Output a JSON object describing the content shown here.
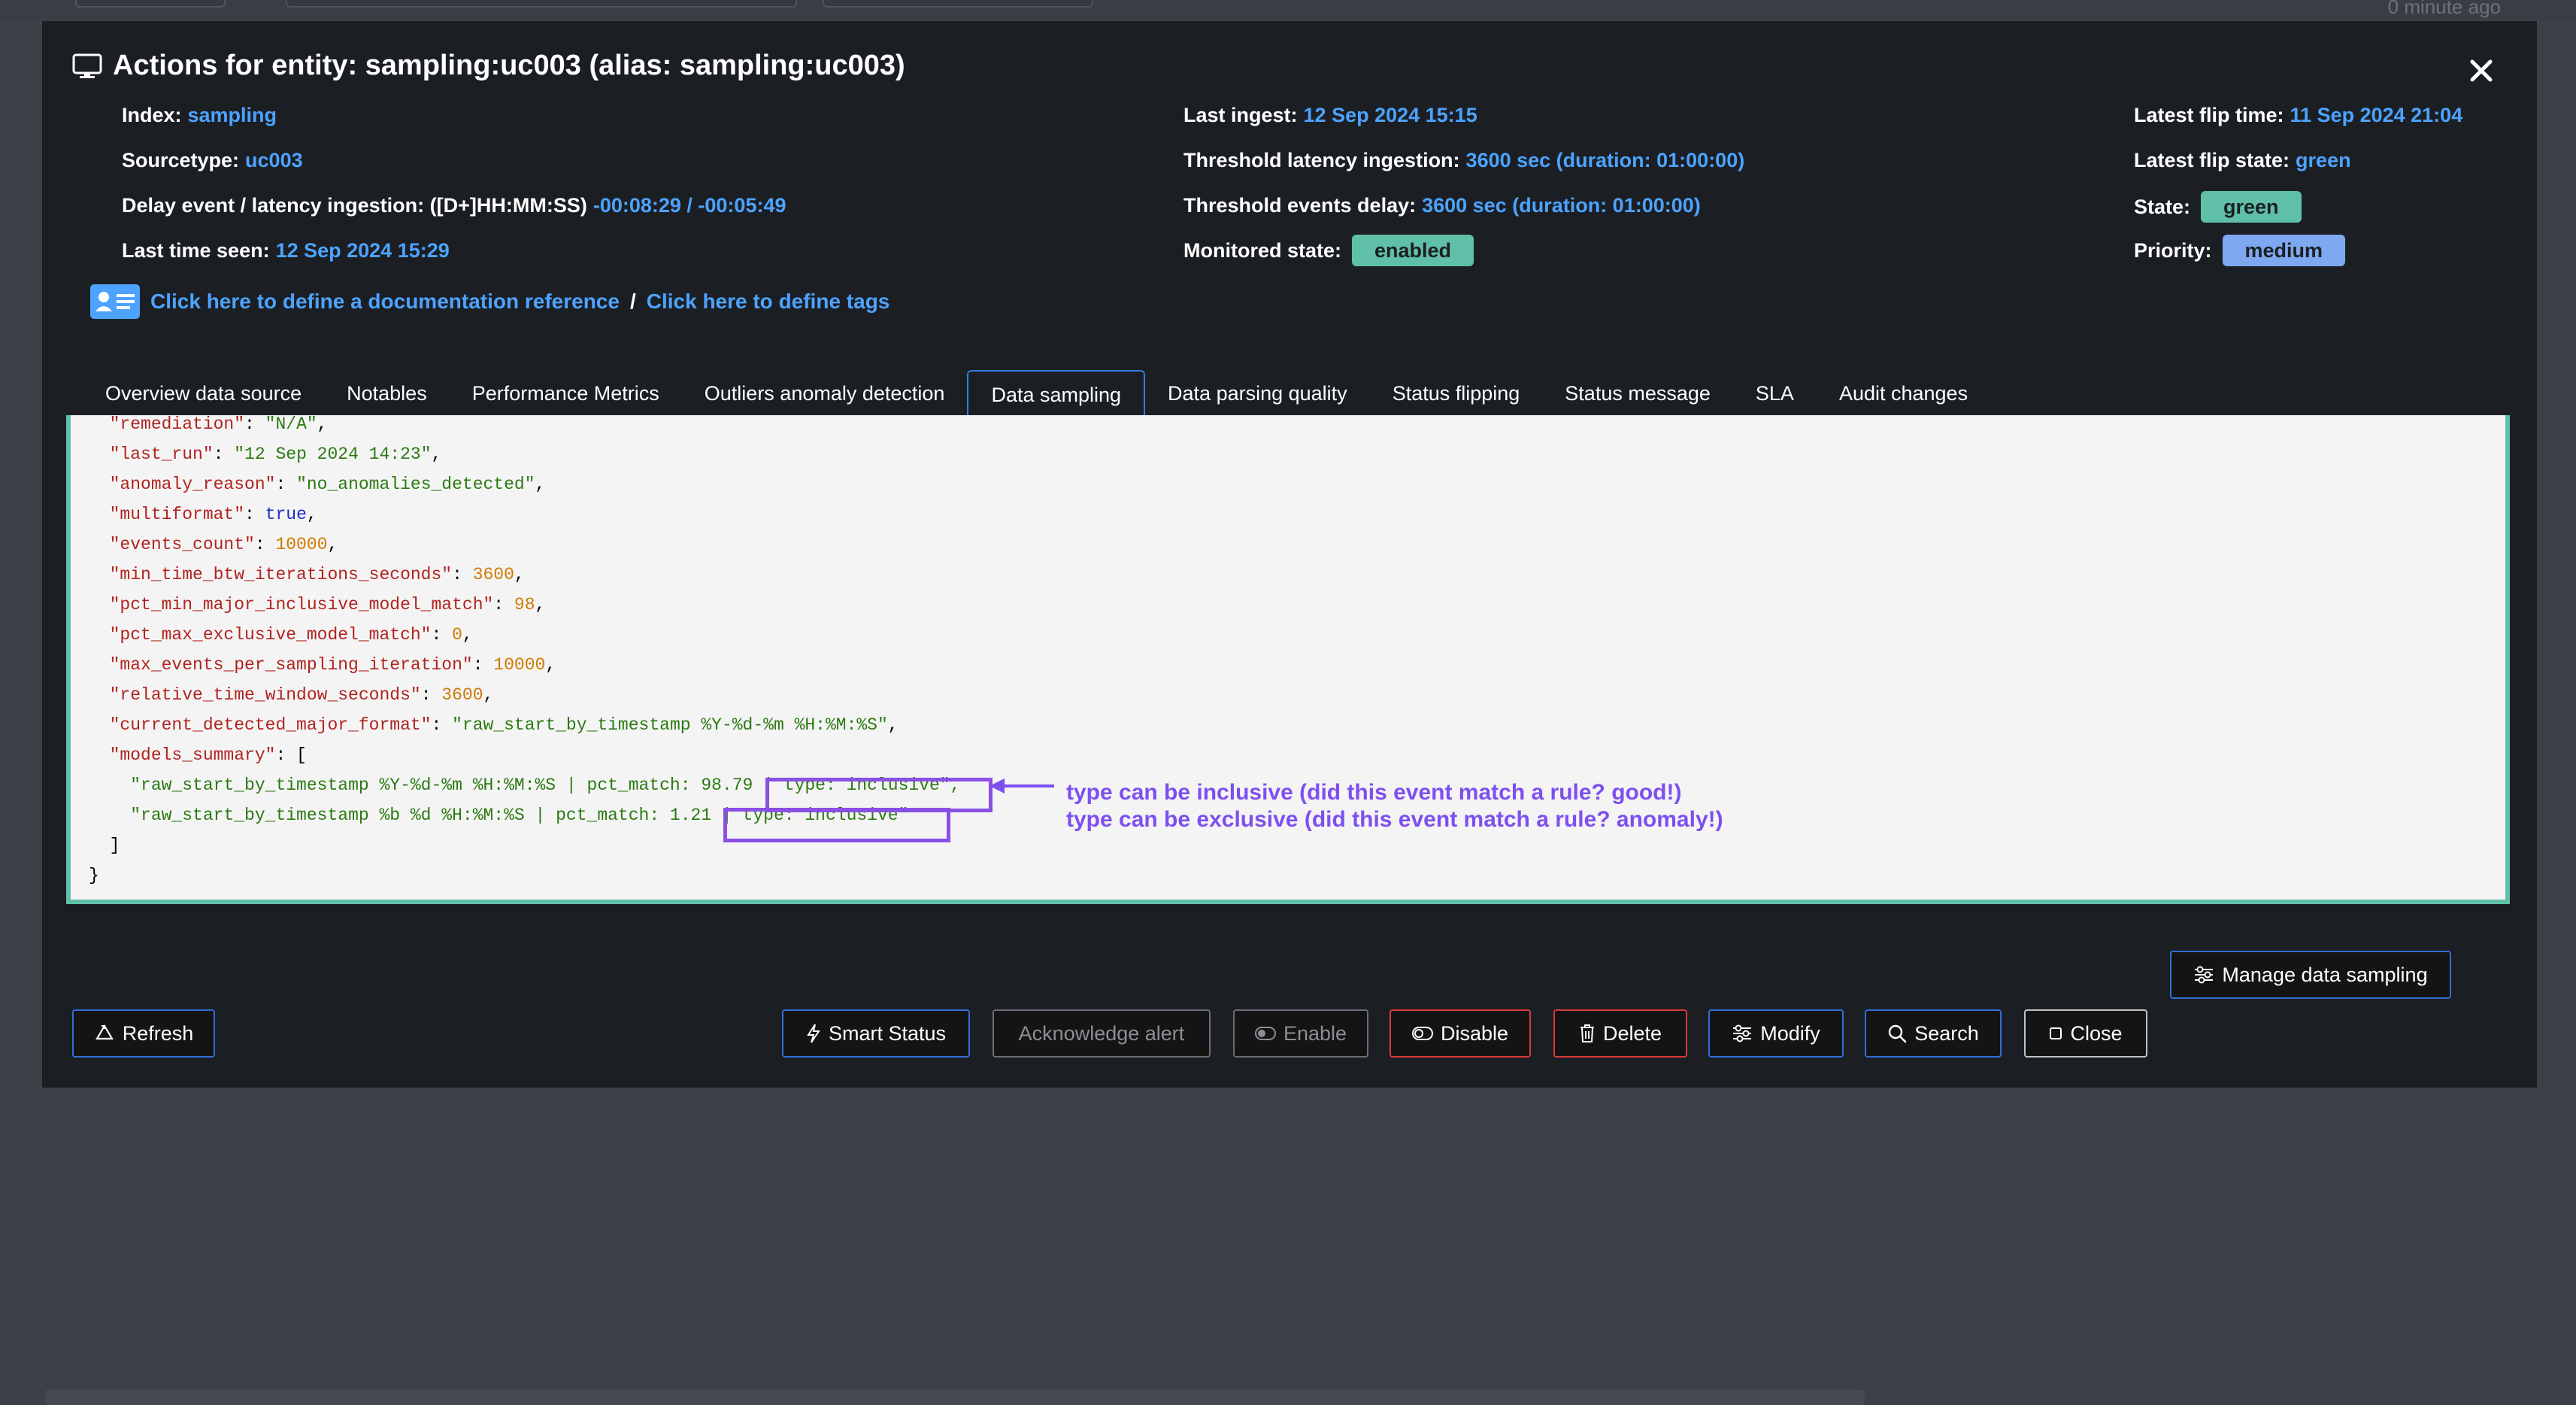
{
  "modal": {
    "title": "Actions for entity: sampling:uc003 (alias: sampling:uc003)"
  },
  "info": {
    "index_label": "Index:",
    "index_value": "sampling",
    "sourcetype_label": "Sourcetype:",
    "sourcetype_value": "uc003",
    "delay_label": "Delay event / latency ingestion: ([D+]HH:MM:SS)",
    "delay_value": "-00:08:29 / -00:05:49",
    "last_seen_label": "Last time seen:",
    "last_seen_value": "12 Sep 2024 15:29",
    "last_ingest_label": "Last ingest:",
    "last_ingest_value": "12 Sep 2024 15:15",
    "threshold_latency_label": "Threshold latency ingestion:",
    "threshold_latency_value": "3600 sec (duration: 01:00:00)",
    "threshold_delay_label": "Threshold events delay:",
    "threshold_delay_value": "3600 sec (duration: 01:00:00)",
    "monitored_state_label": "Monitored state:",
    "monitored_state_value": "enabled",
    "latest_flip_time_label": "Latest flip time:",
    "latest_flip_time_value": "11 Sep 2024 21:04",
    "latest_flip_state_label": "Latest flip state:",
    "latest_flip_state_value": "green",
    "state_label": "State:",
    "state_value": "green",
    "priority_label": "Priority:",
    "priority_value": "medium"
  },
  "links": {
    "doc_reference": "Click here to define a documentation reference",
    "separator": "/",
    "tags": "Click here to define tags"
  },
  "tabs": [
    "Overview data source",
    "Notables",
    "Performance Metrics",
    "Outliers anomaly detection",
    "Data sampling",
    "Data parsing quality",
    "Status flipping",
    "Status message",
    "SLA",
    "Audit changes"
  ],
  "active_tab": "Data sampling",
  "code": {
    "remediation_key": "\"remediation\"",
    "remediation_val": "\"N/A\"",
    "last_run_key": "\"last_run\"",
    "last_run_val": "\"12 Sep 2024 14:23\"",
    "anomaly_reason_key": "\"anomaly_reason\"",
    "anomaly_reason_val": "\"no_anomalies_detected\"",
    "multiformat_key": "\"multiformat\"",
    "multiformat_val": "true",
    "events_count_key": "\"events_count\"",
    "events_count_val": "10000",
    "min_time_key": "\"min_time_btw_iterations_seconds\"",
    "min_time_val": "3600",
    "pct_min_key": "\"pct_min_major_inclusive_model_match\"",
    "pct_min_val": "98",
    "pct_max_key": "\"pct_max_exclusive_model_match\"",
    "pct_max_val": "0",
    "max_events_key": "\"max_events_per_sampling_iteration\"",
    "max_events_val": "10000",
    "relative_key": "\"relative_time_window_seconds\"",
    "relative_val": "3600",
    "current_format_key": "\"current_detected_major_format\"",
    "current_format_val": "\"raw_start_by_timestamp %Y-%d-%m %H:%M:%S\"",
    "models_summary_key": "\"models_summary\"",
    "model_line_1": "\"raw_start_by_timestamp %Y-%d-%m %H:%M:%S | pct_match: 98.79 | type: inclusive\",",
    "model_line_2": "\"raw_start_by_timestamp %b %d %H:%M:%S | pct_match: 1.21 | type: inclusive\"",
    "close_bracket": "]",
    "close_brace": "}"
  },
  "annotation": {
    "line1": "type can be inclusive (did this event match a rule? good!)",
    "line2": "type can be exclusive (did this event match a rule? anomaly!)"
  },
  "buttons": {
    "manage_sampling": "Manage data sampling",
    "refresh": "Refresh",
    "smart_status": "Smart Status",
    "acknowledge": "Acknowledge alert",
    "enable": "Enable",
    "disable": "Disable",
    "delete": "Delete",
    "modify": "Modify",
    "search": "Search",
    "close": "Close"
  },
  "colors": {
    "accent_blue": "#4da3ff",
    "state_green": "#5fbfa7",
    "priority_blue": "#7ea9f0",
    "annotation_purple": "#7e4ff0",
    "danger_red": "#d83a3a"
  },
  "background": {
    "note": "0 minute ago"
  }
}
